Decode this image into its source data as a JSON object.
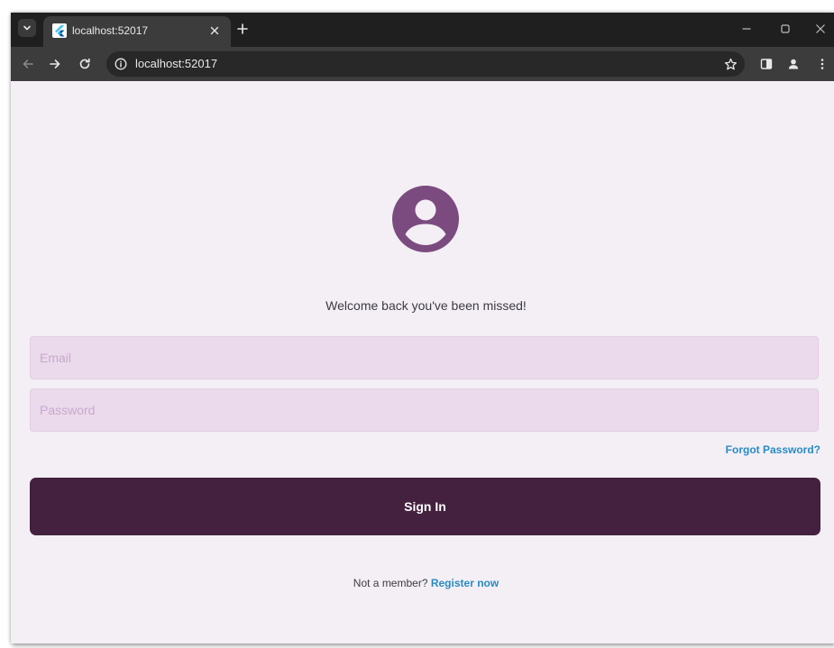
{
  "browser": {
    "tab_title": "localhost:52017",
    "url": "localhost:52017",
    "new_tab_label": "+"
  },
  "login": {
    "welcome_text": "Welcome back you've been missed!",
    "email_placeholder": "Email",
    "password_placeholder": "Password",
    "forgot_password": "Forgot Password?",
    "sign_in_label": "Sign In",
    "not_member_text": "Not a member? ",
    "register_link": "Register now"
  },
  "colors": {
    "accent_primary": "#43213f",
    "avatar": "#7b4b7f",
    "link": "#2a8bc4",
    "page_background": "#f3eff5",
    "field_background": "#eadaeb"
  },
  "icons": {
    "tab_search": "chevron-down-icon",
    "favicon": "flutter-logo-icon",
    "tab_close": "close-icon",
    "new_tab": "plus-icon",
    "minimize": "minimize-icon",
    "maximize": "maximize-icon",
    "close_window": "close-icon",
    "back": "arrow-left-icon",
    "forward": "arrow-right-icon",
    "reload": "reload-icon",
    "site_info": "info-icon",
    "bookmark": "star-icon",
    "side_panel": "side-panel-icon",
    "profile": "person-icon",
    "menu": "more-vertical-icon",
    "avatar": "account-circle-icon"
  }
}
